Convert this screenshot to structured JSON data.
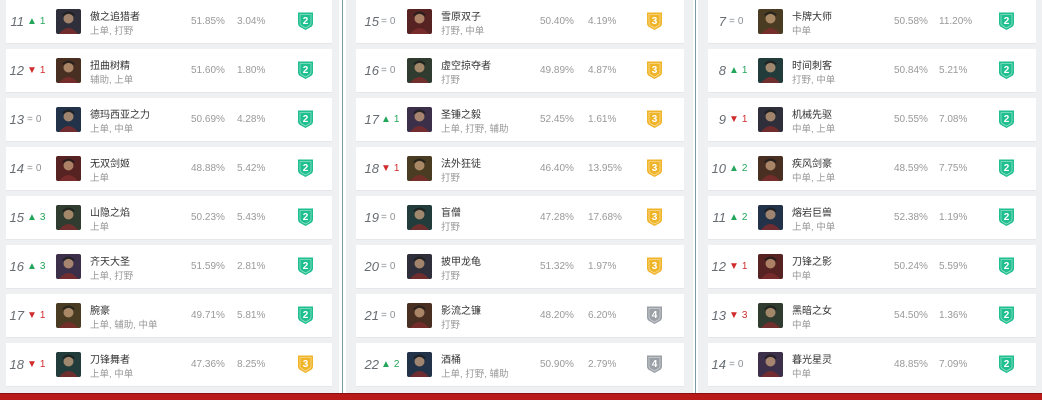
{
  "columns": [
    {
      "rows": [
        {
          "rank": "11",
          "change": "1",
          "dir": "up",
          "name": "傲之追猎者",
          "roles": "上单, 打野",
          "winrate": "51.85%",
          "pickrate": "3.04%",
          "tier": "2",
          "avatar_icon": "champion-portrait-icon"
        },
        {
          "rank": "12",
          "change": "1",
          "dir": "down",
          "name": "扭曲树精",
          "roles": "辅助, 上单",
          "winrate": "51.60%",
          "pickrate": "1.80%",
          "tier": "2",
          "avatar_icon": "champion-portrait-icon"
        },
        {
          "rank": "13",
          "change": "0",
          "dir": "same",
          "name": "德玛西亚之力",
          "roles": "上单, 中单",
          "winrate": "50.69%",
          "pickrate": "4.28%",
          "tier": "2",
          "avatar_icon": "champion-portrait-icon"
        },
        {
          "rank": "14",
          "change": "0",
          "dir": "same",
          "name": "无双剑姬",
          "roles": "上单",
          "winrate": "48.88%",
          "pickrate": "5.42%",
          "tier": "2",
          "avatar_icon": "champion-portrait-icon"
        },
        {
          "rank": "15",
          "change": "3",
          "dir": "up",
          "name": "山隐之焰",
          "roles": "上单",
          "winrate": "50.23%",
          "pickrate": "5.43%",
          "tier": "2",
          "avatar_icon": "champion-portrait-icon"
        },
        {
          "rank": "16",
          "change": "3",
          "dir": "up",
          "name": "齐天大圣",
          "roles": "上单, 打野",
          "winrate": "51.59%",
          "pickrate": "2.81%",
          "tier": "2",
          "avatar_icon": "champion-portrait-icon"
        },
        {
          "rank": "17",
          "change": "1",
          "dir": "down",
          "name": "腕豪",
          "roles": "上单, 辅助, 中单",
          "winrate": "49.71%",
          "pickrate": "5.81%",
          "tier": "2",
          "avatar_icon": "champion-portrait-icon"
        },
        {
          "rank": "18",
          "change": "1",
          "dir": "down",
          "name": "刀锋舞者",
          "roles": "上单, 中单",
          "winrate": "47.36%",
          "pickrate": "8.25%",
          "tier": "3",
          "avatar_icon": "champion-portrait-icon"
        }
      ]
    },
    {
      "rows": [
        {
          "rank": "15",
          "change": "0",
          "dir": "same",
          "name": "雪原双子",
          "roles": "打野, 中单",
          "winrate": "50.40%",
          "pickrate": "4.19%",
          "tier": "3",
          "avatar_icon": "champion-portrait-icon"
        },
        {
          "rank": "16",
          "change": "0",
          "dir": "same",
          "name": "虚空掠夺者",
          "roles": "打野",
          "winrate": "49.89%",
          "pickrate": "4.87%",
          "tier": "3",
          "avatar_icon": "champion-portrait-icon"
        },
        {
          "rank": "17",
          "change": "1",
          "dir": "up",
          "name": "圣锤之毅",
          "roles": "上单, 打野, 辅助",
          "winrate": "52.45%",
          "pickrate": "1.61%",
          "tier": "3",
          "avatar_icon": "champion-portrait-icon"
        },
        {
          "rank": "18",
          "change": "1",
          "dir": "down",
          "name": "法外狂徒",
          "roles": "打野",
          "winrate": "46.40%",
          "pickrate": "13.95%",
          "tier": "3",
          "avatar_icon": "champion-portrait-icon"
        },
        {
          "rank": "19",
          "change": "0",
          "dir": "same",
          "name": "盲僧",
          "roles": "打野",
          "winrate": "47.28%",
          "pickrate": "17.68%",
          "tier": "3",
          "avatar_icon": "champion-portrait-icon"
        },
        {
          "rank": "20",
          "change": "0",
          "dir": "same",
          "name": "披甲龙龟",
          "roles": "打野",
          "winrate": "51.32%",
          "pickrate": "1.97%",
          "tier": "3",
          "avatar_icon": "champion-portrait-icon"
        },
        {
          "rank": "21",
          "change": "0",
          "dir": "same",
          "name": "影流之镰",
          "roles": "打野",
          "winrate": "48.20%",
          "pickrate": "6.20%",
          "tier": "4",
          "avatar_icon": "champion-portrait-icon"
        },
        {
          "rank": "22",
          "change": "2",
          "dir": "up",
          "name": "酒桶",
          "roles": "上单, 打野, 辅助",
          "winrate": "50.90%",
          "pickrate": "2.79%",
          "tier": "4",
          "avatar_icon": "champion-portrait-icon"
        }
      ]
    },
    {
      "rows": [
        {
          "rank": "7",
          "change": "0",
          "dir": "same",
          "name": "卡牌大师",
          "roles": "中单",
          "winrate": "50.58%",
          "pickrate": "11.20%",
          "tier": "2",
          "avatar_icon": "champion-portrait-icon"
        },
        {
          "rank": "8",
          "change": "1",
          "dir": "up",
          "name": "时间刺客",
          "roles": "打野, 中单",
          "winrate": "50.84%",
          "pickrate": "5.21%",
          "tier": "2",
          "avatar_icon": "champion-portrait-icon"
        },
        {
          "rank": "9",
          "change": "1",
          "dir": "down",
          "name": "机械先驱",
          "roles": "中单, 上单",
          "winrate": "50.55%",
          "pickrate": "7.08%",
          "tier": "2",
          "avatar_icon": "champion-portrait-icon"
        },
        {
          "rank": "10",
          "change": "2",
          "dir": "up",
          "name": "疾风剑豪",
          "roles": "中单, 上单",
          "winrate": "48.59%",
          "pickrate": "7.75%",
          "tier": "2",
          "avatar_icon": "champion-portrait-icon"
        },
        {
          "rank": "11",
          "change": "2",
          "dir": "up",
          "name": "熔岩巨兽",
          "roles": "上单, 中单",
          "winrate": "52.38%",
          "pickrate": "1.19%",
          "tier": "2",
          "avatar_icon": "champion-portrait-icon"
        },
        {
          "rank": "12",
          "change": "1",
          "dir": "down",
          "name": "刀锋之影",
          "roles": "中单",
          "winrate": "50.24%",
          "pickrate": "5.59%",
          "tier": "2",
          "avatar_icon": "champion-portrait-icon"
        },
        {
          "rank": "13",
          "change": "3",
          "dir": "down",
          "name": "黑暗之女",
          "roles": "中单",
          "winrate": "54.50%",
          "pickrate": "1.36%",
          "tier": "2",
          "avatar_icon": "champion-portrait-icon"
        },
        {
          "rank": "14",
          "change": "0",
          "dir": "same",
          "name": "暮光星灵",
          "roles": "中单",
          "winrate": "48.85%",
          "pickrate": "7.09%",
          "tier": "2",
          "avatar_icon": "champion-portrait-icon"
        }
      ]
    }
  ],
  "tier_colors": {
    "2": "#1fbf8f",
    "3": "#f0b429",
    "4": "#9aa0a6"
  },
  "change_glyphs": {
    "up": "▲",
    "down": "▼",
    "same": "="
  },
  "change_colors": {
    "up": "#23a55a",
    "down": "#d12a2a",
    "same": "#8c9196"
  },
  "avatar_palette": [
    "#3a3a48",
    "#5a3a2a",
    "#2a3f5a",
    "#6a2a2a",
    "#3a4a3a",
    "#4a3a5a",
    "#5a4a2a",
    "#2a4a4a"
  ]
}
